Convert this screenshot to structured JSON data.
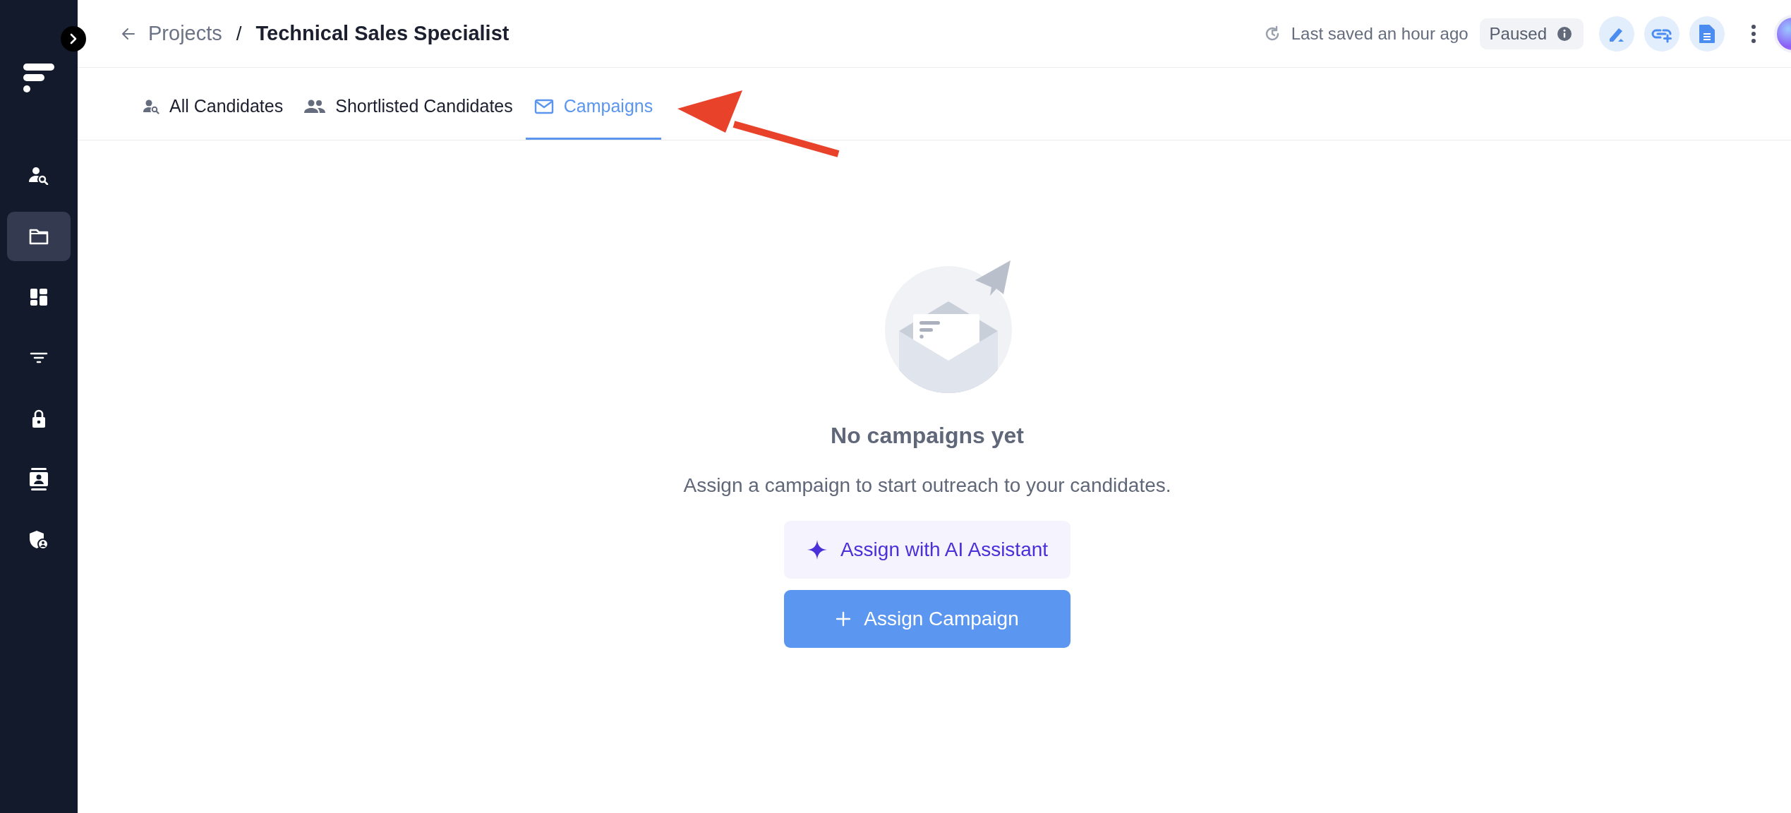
{
  "sidebar": {
    "items": [
      {
        "selected": false
      },
      {
        "selected": true
      },
      {
        "selected": false
      },
      {
        "selected": false
      },
      {
        "selected": false
      },
      {
        "selected": false
      },
      {
        "selected": false
      }
    ]
  },
  "breadcrumb": {
    "parent": "Projects",
    "separator": "/",
    "current": "Technical Sales Specialist"
  },
  "header": {
    "saved_status": "Last saved an hour ago",
    "status_badge": "Paused"
  },
  "tabs": [
    {
      "label": "All Candidates",
      "selected": false
    },
    {
      "label": "Shortlisted Candidates",
      "selected": false
    },
    {
      "label": "Campaigns",
      "selected": true
    }
  ],
  "empty_state": {
    "title": "No campaigns yet",
    "message": "Assign a campaign to start outreach to your candidates.",
    "buttons": [
      {
        "kind": "ai",
        "label": "Assign with AI Assistant"
      },
      {
        "kind": "primary",
        "label": "Assign Campaign"
      }
    ]
  }
}
